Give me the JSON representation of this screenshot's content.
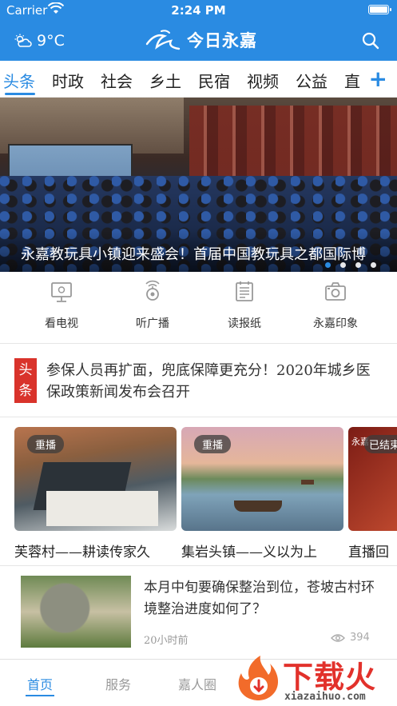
{
  "status_bar": {
    "carrier": "Carrier",
    "time": "2:24 PM"
  },
  "header": {
    "weather": "9°C",
    "app_title": "今日永嘉",
    "logo_icon": "yongjia-logo-icon",
    "search_icon": "search-icon",
    "accent_color": "#2a8be2"
  },
  "channels": {
    "items": [
      {
        "label": "头条",
        "active": true
      },
      {
        "label": "时政"
      },
      {
        "label": "社会"
      },
      {
        "label": "乡土"
      },
      {
        "label": "民宿"
      },
      {
        "label": "视频"
      },
      {
        "label": "公益"
      },
      {
        "label": "直"
      }
    ],
    "add_label": "+"
  },
  "banner": {
    "caption": "永嘉教玩具小镇迎来盛会！首届中国教玩具之都国际博",
    "dots_count": 4,
    "active_dot": 1
  },
  "quick_entries": [
    {
      "label": "看电视",
      "icon": "tv-icon"
    },
    {
      "label": "听广播",
      "icon": "radio-icon"
    },
    {
      "label": "读报纸",
      "icon": "newspaper-icon"
    },
    {
      "label": "永嘉印象",
      "icon": "camera-icon"
    }
  ],
  "headline": {
    "badge": "头条",
    "text": "参保人员再扩面，兜底保障更充分！2020年城乡医保政策新闻发布会召开"
  },
  "video_cards": [
    {
      "badge": "重播",
      "title": "芙蓉村——耕读传家久"
    },
    {
      "badge": "重播",
      "title": "集岩头镇——义以为上"
    },
    {
      "badge": "已结束",
      "title": "直播回",
      "logo_text": "永嘉"
    }
  ],
  "article": {
    "title": "本月中旬要确保整治到位，苍坡古村环境整治进度如何了？",
    "time": "20小时前",
    "views": "394"
  },
  "bottom_nav": {
    "items": [
      {
        "label": "首页",
        "active": true
      },
      {
        "label": "服务"
      },
      {
        "label": "嘉人圈"
      }
    ]
  },
  "watermark": {
    "text": "下载火",
    "url": "xiazaihuo.com"
  }
}
